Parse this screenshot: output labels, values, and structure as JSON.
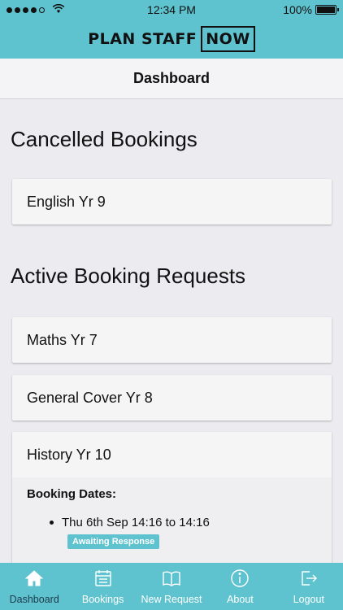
{
  "status": {
    "time": "12:34 PM",
    "battery": "100%",
    "wifi_icon": "wifi-icon"
  },
  "brand": {
    "word1": "PLAN STAFF",
    "word2": "NOW"
  },
  "nav": {
    "title": "Dashboard"
  },
  "sections": {
    "cancelled": {
      "title": "Cancelled Bookings",
      "items": [
        "English Yr 9"
      ]
    },
    "active": {
      "title": "Active Booking Requests",
      "items": [
        "Maths Yr 7",
        "General Cover Yr 8",
        "History Yr 10"
      ],
      "expanded": {
        "dates_label": "Booking Dates:",
        "date_entry": "Thu 6th Sep 14:16 to 14:16",
        "status": "Awaiting Response"
      }
    }
  },
  "tabs": [
    {
      "label": "Dashboard",
      "icon": "home-icon",
      "active": true
    },
    {
      "label": "Bookings",
      "icon": "calendar-icon"
    },
    {
      "label": "New Request",
      "icon": "book-icon"
    },
    {
      "label": "About",
      "icon": "info-icon"
    },
    {
      "label": "Logout",
      "icon": "logout-icon"
    }
  ],
  "colors": {
    "accent": "#5fc3cf",
    "active_tab": "#1e3a4c"
  }
}
